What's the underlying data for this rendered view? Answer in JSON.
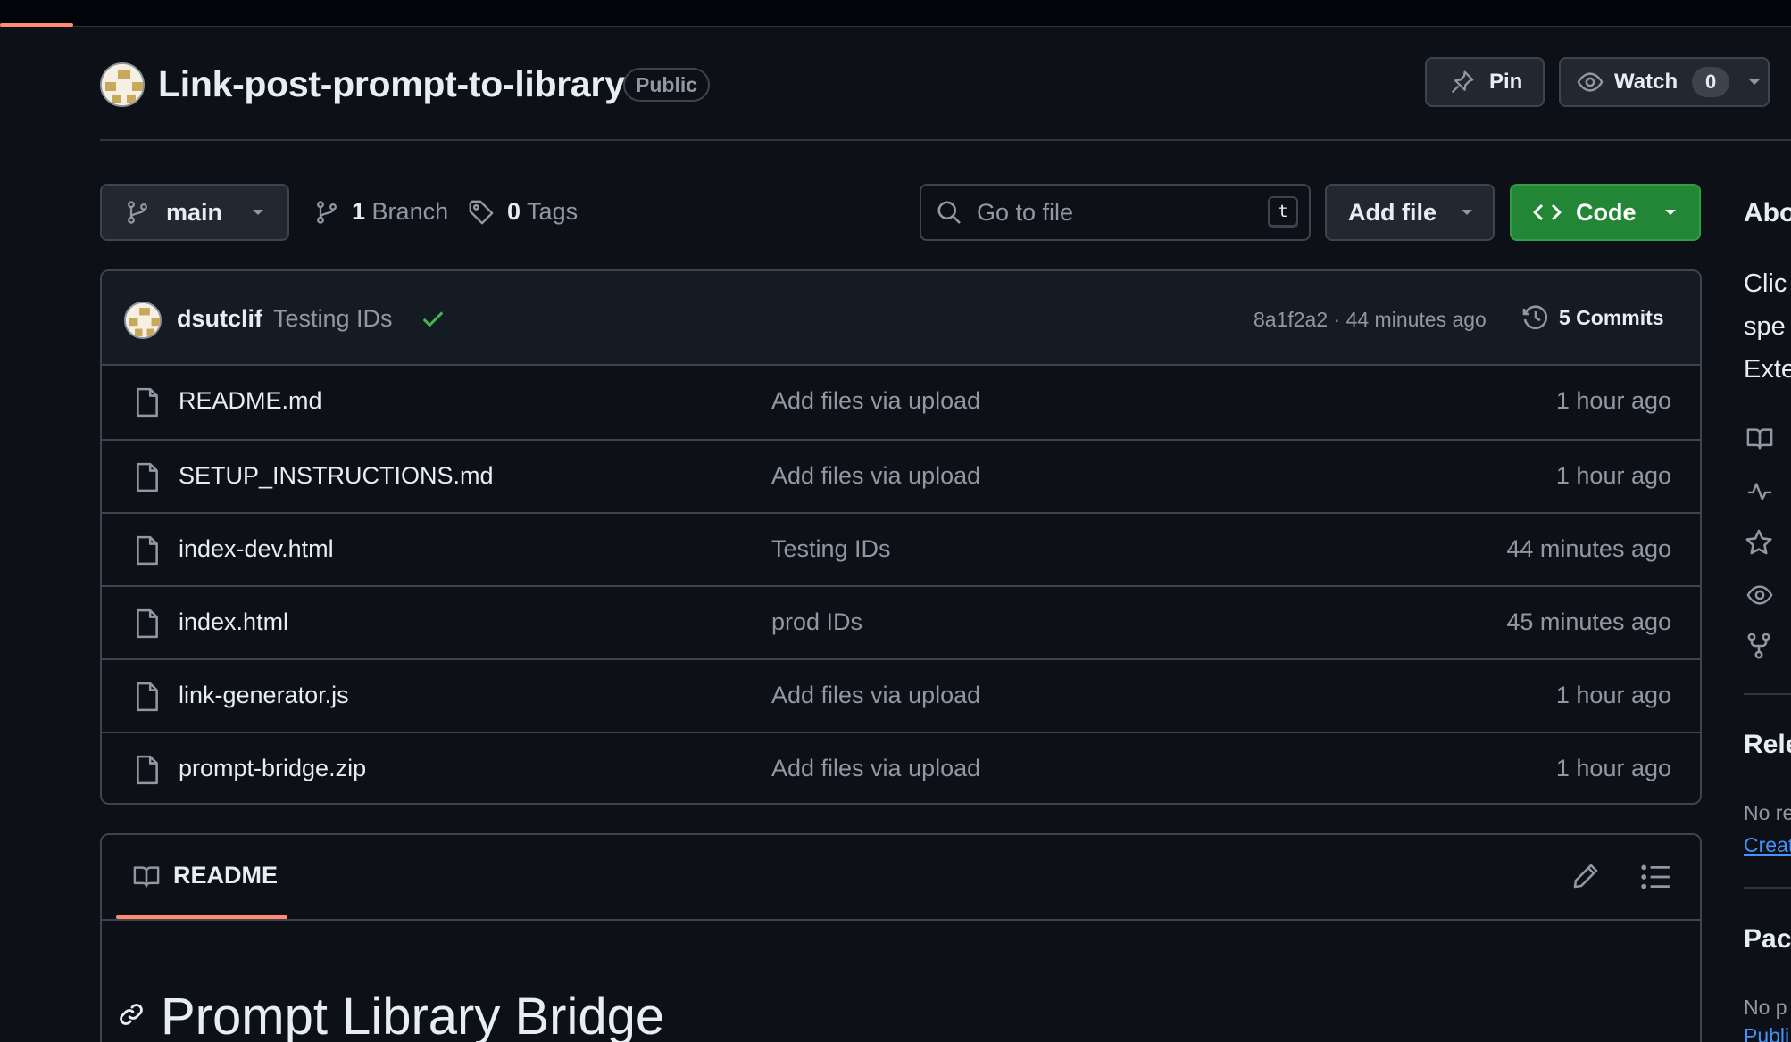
{
  "repo": {
    "name": "Link-post-prompt-to-library",
    "visibility": "Public",
    "pin_label": "Pin",
    "watch_label": "Watch",
    "watch_count": "0"
  },
  "toolbar": {
    "branch": "main",
    "branch_count": "1",
    "branch_label": "Branch",
    "tag_count": "0",
    "tag_label": "Tags",
    "goto_placeholder": "Go to file",
    "goto_shortcut": "t",
    "add_file_label": "Add file",
    "code_label": "Code"
  },
  "latest_commit": {
    "author": "dsutclif",
    "message": "Testing IDs",
    "meta": "8a1f2a2 · 44 minutes ago",
    "commits_label": "5 Commits"
  },
  "files": [
    {
      "name": "README.md",
      "commit": "Add files via upload",
      "time": "1 hour ago"
    },
    {
      "name": "SETUP_INSTRUCTIONS.md",
      "commit": "Add files via upload",
      "time": "1 hour ago"
    },
    {
      "name": "index-dev.html",
      "commit": "Testing IDs",
      "time": "44 minutes ago"
    },
    {
      "name": "index.html",
      "commit": "prod IDs",
      "time": "45 minutes ago"
    },
    {
      "name": "link-generator.js",
      "commit": "Add files via upload",
      "time": "1 hour ago"
    },
    {
      "name": "prompt-bridge.zip",
      "commit": "Add files via upload",
      "time": "1 hour ago"
    }
  ],
  "readme": {
    "tab_label": "README",
    "heading": "Prompt Library Bridge"
  },
  "sidebar": {
    "about_title": "Abo",
    "desc_lines": [
      "Clic",
      "spe",
      "Exte"
    ],
    "releases_title": "Rele",
    "releases_empty": "No re",
    "releases_link": "Creat",
    "packages_title": "Pacl",
    "packages_empty": "No p",
    "packages_link": "Publi"
  },
  "colors": {
    "background": "#0d1117",
    "accent_underline": "#fd8c73",
    "code_button": "#238636",
    "check_green": "#3fb950",
    "link_blue": "#4493f8"
  }
}
